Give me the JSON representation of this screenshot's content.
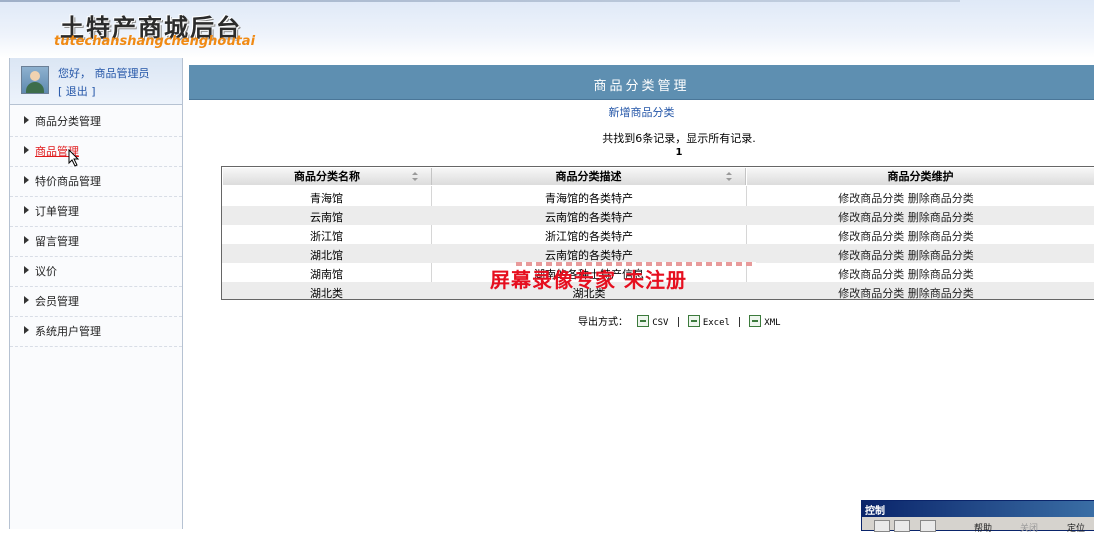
{
  "header": {
    "logo_cn": "土特产商城后台",
    "logo_en": "tutechanshangchenghoutai"
  },
  "user": {
    "greeting": "您好， 商品管理员",
    "logout": "[ 退出 ]"
  },
  "nav": {
    "items": [
      {
        "label": "商品分类管理"
      },
      {
        "label": "商品管理"
      },
      {
        "label": "特价商品管理"
      },
      {
        "label": "订单管理"
      },
      {
        "label": "留言管理"
      },
      {
        "label": "议价"
      },
      {
        "label": "会员管理"
      },
      {
        "label": "系统用户管理"
      }
    ],
    "active_index": 1
  },
  "main": {
    "title": "商品分类管理",
    "add_link": "新增商品分类",
    "summary": "共找到6条记录，显示所有记录.",
    "page": "1"
  },
  "table": {
    "headers": [
      "商品分类名称",
      "商品分类描述",
      "商品分类维护"
    ],
    "rows": [
      {
        "name": "青海馆",
        "desc": "青海馆的各类特产",
        "edit": "修改商品分类",
        "del": "删除商品分类"
      },
      {
        "name": "云南馆",
        "desc": "云南馆的各类特产",
        "edit": "修改商品分类",
        "del": "删除商品分类"
      },
      {
        "name": "浙江馆",
        "desc": "浙江馆的各类特产",
        "edit": "修改商品分类",
        "del": "删除商品分类"
      },
      {
        "name": "湖北馆",
        "desc": "云南馆的各类特产",
        "edit": "修改商品分类",
        "del": "删除商品分类"
      },
      {
        "name": "湖南馆",
        "desc": "湖南的各种土特产信息",
        "edit": "修改商品分类",
        "del": "删除商品分类"
      },
      {
        "name": "湖北类",
        "desc": "湖北类",
        "edit": "修改商品分类",
        "del": "删除商品分类"
      }
    ]
  },
  "export": {
    "label": "导出方式：",
    "options": [
      "CSV",
      "Excel",
      "XML"
    ]
  },
  "watermark": "屏幕录像专家 未注册",
  "control_window": {
    "title": "控制",
    "buttons": [
      "帮助",
      "关闭",
      "定位"
    ]
  }
}
